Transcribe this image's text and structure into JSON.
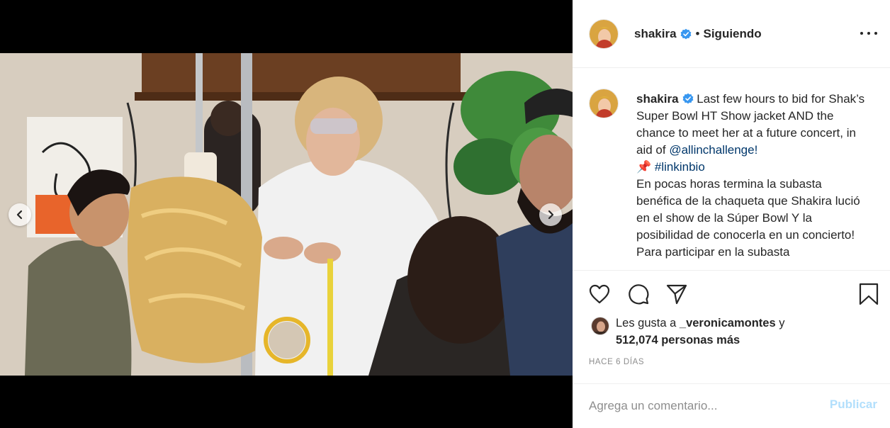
{
  "post": {
    "username": "shakira",
    "follow_status": "Siguiendo",
    "separator": "•",
    "caption": {
      "username": "shakira",
      "text_1": " Last few hours to bid for Shak’s Super Bowl HT Show jacket AND the chance to meet her at a future concert, in aid of ",
      "mention": "@allinchallenge!",
      "pin": "📌",
      "hashtag": "#linkinbio",
      "text_2": "En pocas horas termina la subasta benéfica de la chaqueta que Shakira lució en el show de la Súper Bowl Y la posibilidad de conocerla en un concierto! Para participar en la subasta"
    },
    "likes": {
      "prefix": "Les gusta a ",
      "liker": "_veronicamontes",
      "conjunction": " y",
      "others": "512,074 personas más"
    },
    "timestamp": "HACE 6 DÍAS"
  },
  "comment": {
    "placeholder": "Agrega un comentario...",
    "publish_label": "Publicar"
  },
  "icons": {
    "verified": "verified-badge-icon",
    "more": "more-options-icon",
    "like": "heart-icon",
    "comment": "comment-bubble-icon",
    "share": "paper-plane-icon",
    "save": "bookmark-icon",
    "prev": "chevron-left-icon",
    "next": "chevron-right-icon"
  },
  "colors": {
    "verified_blue": "#3897f0",
    "link": "#00376b",
    "muted": "#8e8e8e",
    "publish_disabled": "#b2dffc",
    "text": "#262626"
  }
}
